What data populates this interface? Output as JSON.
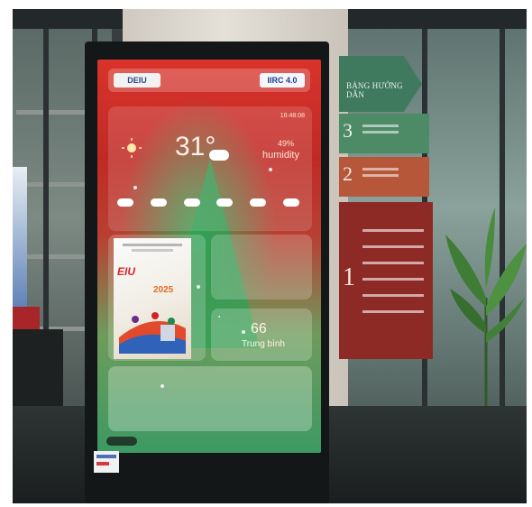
{
  "kiosk": {
    "header": {
      "left_logo": "DEIU",
      "center_text": "",
      "right_logo": "IIRC 4.0"
    },
    "weather": {
      "location": "",
      "date": "",
      "time": "16:48:08",
      "temperature": "31°",
      "humidity_value": "49%",
      "humidity_label": "humidity",
      "forecast": []
    },
    "poster": {
      "brand": "EIU",
      "year": "2025"
    },
    "air_quality": {
      "title": "",
      "aqi_value": "66",
      "aqi_status": "Trung bình"
    },
    "notice": {
      "lines": []
    }
  },
  "signage": {
    "header_title": "BẢNG HƯỚNG DẪN",
    "floors": [
      "3",
      "2",
      "1"
    ]
  },
  "colors": {
    "screen_red": "#c02a25",
    "screen_green": "#3c9a63",
    "sign_green": "#3f7a5e",
    "sign_orange": "#b7573a",
    "sign_red": "#8e2a25"
  }
}
